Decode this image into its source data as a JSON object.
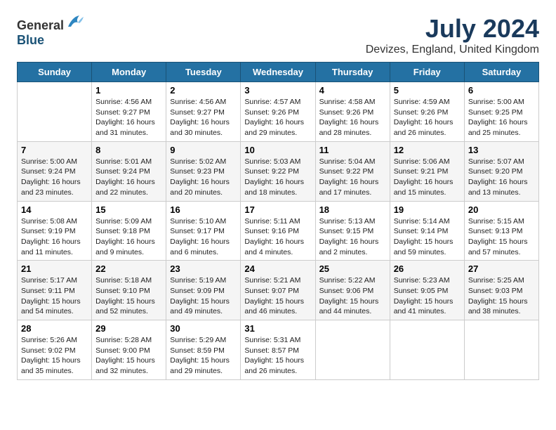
{
  "header": {
    "logo_general": "General",
    "logo_blue": "Blue",
    "title": "July 2024",
    "subtitle": "Devizes, England, United Kingdom"
  },
  "days_of_week": [
    "Sunday",
    "Monday",
    "Tuesday",
    "Wednesday",
    "Thursday",
    "Friday",
    "Saturday"
  ],
  "weeks": [
    [
      {
        "date": "",
        "sunrise": "",
        "sunset": "",
        "daylight": ""
      },
      {
        "date": "1",
        "sunrise": "Sunrise: 4:56 AM",
        "sunset": "Sunset: 9:27 PM",
        "daylight": "Daylight: 16 hours and 31 minutes."
      },
      {
        "date": "2",
        "sunrise": "Sunrise: 4:56 AM",
        "sunset": "Sunset: 9:27 PM",
        "daylight": "Daylight: 16 hours and 30 minutes."
      },
      {
        "date": "3",
        "sunrise": "Sunrise: 4:57 AM",
        "sunset": "Sunset: 9:26 PM",
        "daylight": "Daylight: 16 hours and 29 minutes."
      },
      {
        "date": "4",
        "sunrise": "Sunrise: 4:58 AM",
        "sunset": "Sunset: 9:26 PM",
        "daylight": "Daylight: 16 hours and 28 minutes."
      },
      {
        "date": "5",
        "sunrise": "Sunrise: 4:59 AM",
        "sunset": "Sunset: 9:26 PM",
        "daylight": "Daylight: 16 hours and 26 minutes."
      },
      {
        "date": "6",
        "sunrise": "Sunrise: 5:00 AM",
        "sunset": "Sunset: 9:25 PM",
        "daylight": "Daylight: 16 hours and 25 minutes."
      }
    ],
    [
      {
        "date": "7",
        "sunrise": "Sunrise: 5:00 AM",
        "sunset": "Sunset: 9:24 PM",
        "daylight": "Daylight: 16 hours and 23 minutes."
      },
      {
        "date": "8",
        "sunrise": "Sunrise: 5:01 AM",
        "sunset": "Sunset: 9:24 PM",
        "daylight": "Daylight: 16 hours and 22 minutes."
      },
      {
        "date": "9",
        "sunrise": "Sunrise: 5:02 AM",
        "sunset": "Sunset: 9:23 PM",
        "daylight": "Daylight: 16 hours and 20 minutes."
      },
      {
        "date": "10",
        "sunrise": "Sunrise: 5:03 AM",
        "sunset": "Sunset: 9:22 PM",
        "daylight": "Daylight: 16 hours and 18 minutes."
      },
      {
        "date": "11",
        "sunrise": "Sunrise: 5:04 AM",
        "sunset": "Sunset: 9:22 PM",
        "daylight": "Daylight: 16 hours and 17 minutes."
      },
      {
        "date": "12",
        "sunrise": "Sunrise: 5:06 AM",
        "sunset": "Sunset: 9:21 PM",
        "daylight": "Daylight: 16 hours and 15 minutes."
      },
      {
        "date": "13",
        "sunrise": "Sunrise: 5:07 AM",
        "sunset": "Sunset: 9:20 PM",
        "daylight": "Daylight: 16 hours and 13 minutes."
      }
    ],
    [
      {
        "date": "14",
        "sunrise": "Sunrise: 5:08 AM",
        "sunset": "Sunset: 9:19 PM",
        "daylight": "Daylight: 16 hours and 11 minutes."
      },
      {
        "date": "15",
        "sunrise": "Sunrise: 5:09 AM",
        "sunset": "Sunset: 9:18 PM",
        "daylight": "Daylight: 16 hours and 9 minutes."
      },
      {
        "date": "16",
        "sunrise": "Sunrise: 5:10 AM",
        "sunset": "Sunset: 9:17 PM",
        "daylight": "Daylight: 16 hours and 6 minutes."
      },
      {
        "date": "17",
        "sunrise": "Sunrise: 5:11 AM",
        "sunset": "Sunset: 9:16 PM",
        "daylight": "Daylight: 16 hours and 4 minutes."
      },
      {
        "date": "18",
        "sunrise": "Sunrise: 5:13 AM",
        "sunset": "Sunset: 9:15 PM",
        "daylight": "Daylight: 16 hours and 2 minutes."
      },
      {
        "date": "19",
        "sunrise": "Sunrise: 5:14 AM",
        "sunset": "Sunset: 9:14 PM",
        "daylight": "Daylight: 15 hours and 59 minutes."
      },
      {
        "date": "20",
        "sunrise": "Sunrise: 5:15 AM",
        "sunset": "Sunset: 9:13 PM",
        "daylight": "Daylight: 15 hours and 57 minutes."
      }
    ],
    [
      {
        "date": "21",
        "sunrise": "Sunrise: 5:17 AM",
        "sunset": "Sunset: 9:11 PM",
        "daylight": "Daylight: 15 hours and 54 minutes."
      },
      {
        "date": "22",
        "sunrise": "Sunrise: 5:18 AM",
        "sunset": "Sunset: 9:10 PM",
        "daylight": "Daylight: 15 hours and 52 minutes."
      },
      {
        "date": "23",
        "sunrise": "Sunrise: 5:19 AM",
        "sunset": "Sunset: 9:09 PM",
        "daylight": "Daylight: 15 hours and 49 minutes."
      },
      {
        "date": "24",
        "sunrise": "Sunrise: 5:21 AM",
        "sunset": "Sunset: 9:07 PM",
        "daylight": "Daylight: 15 hours and 46 minutes."
      },
      {
        "date": "25",
        "sunrise": "Sunrise: 5:22 AM",
        "sunset": "Sunset: 9:06 PM",
        "daylight": "Daylight: 15 hours and 44 minutes."
      },
      {
        "date": "26",
        "sunrise": "Sunrise: 5:23 AM",
        "sunset": "Sunset: 9:05 PM",
        "daylight": "Daylight: 15 hours and 41 minutes."
      },
      {
        "date": "27",
        "sunrise": "Sunrise: 5:25 AM",
        "sunset": "Sunset: 9:03 PM",
        "daylight": "Daylight: 15 hours and 38 minutes."
      }
    ],
    [
      {
        "date": "28",
        "sunrise": "Sunrise: 5:26 AM",
        "sunset": "Sunset: 9:02 PM",
        "daylight": "Daylight: 15 hours and 35 minutes."
      },
      {
        "date": "29",
        "sunrise": "Sunrise: 5:28 AM",
        "sunset": "Sunset: 9:00 PM",
        "daylight": "Daylight: 15 hours and 32 minutes."
      },
      {
        "date": "30",
        "sunrise": "Sunrise: 5:29 AM",
        "sunset": "Sunset: 8:59 PM",
        "daylight": "Daylight: 15 hours and 29 minutes."
      },
      {
        "date": "31",
        "sunrise": "Sunrise: 5:31 AM",
        "sunset": "Sunset: 8:57 PM",
        "daylight": "Daylight: 15 hours and 26 minutes."
      },
      {
        "date": "",
        "sunrise": "",
        "sunset": "",
        "daylight": ""
      },
      {
        "date": "",
        "sunrise": "",
        "sunset": "",
        "daylight": ""
      },
      {
        "date": "",
        "sunrise": "",
        "sunset": "",
        "daylight": ""
      }
    ]
  ]
}
